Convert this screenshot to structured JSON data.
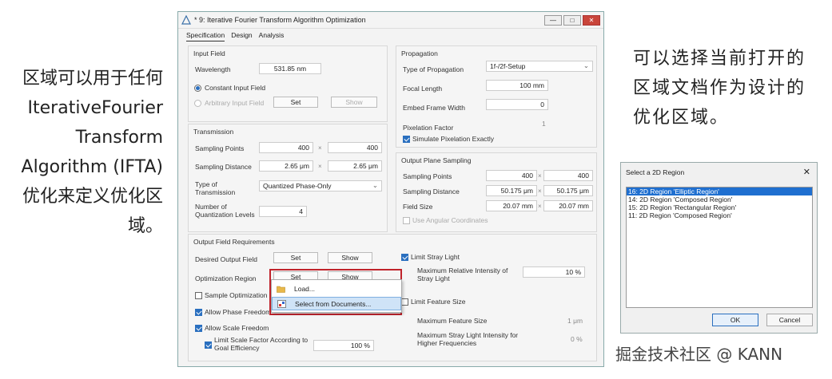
{
  "annotations": {
    "left": "区域可以用于任何 IterativeFourier Transform Algorithm (IFTA)优化来定义优化区域。",
    "right": "可以选择当前打开的区域文档作为设计的优化区域。",
    "watermark": "掘金技术社区 @ KANN"
  },
  "window": {
    "title": "* 9: Iterative Fourier Transform Algorithm Optimization",
    "buttons": {
      "minimize": "—",
      "maximize": "□",
      "close": "✕"
    },
    "tabs": [
      "Specification",
      "Design",
      "Analysis"
    ]
  },
  "input_field": {
    "title": "Input Field",
    "wavelength_label": "Wavelength",
    "wavelength_value": "531.85 nm",
    "constant_label": "Constant Input Field",
    "arbitrary_label": "Arbitrary Input Field",
    "set_label": "Set",
    "show_label": "Show"
  },
  "transmission": {
    "title": "Transmission",
    "sampling_points_label": "Sampling Points",
    "sampling_points_x": "400",
    "sampling_points_y": "400",
    "sampling_distance_label": "Sampling Distance",
    "sampling_distance_x": "2.65 μm",
    "sampling_distance_y": "2.65 μm",
    "type_label": "Type of Transmission",
    "type_value": "Quantized Phase-Only",
    "levels_label": "Number of Quantization Levels",
    "levels_value": "4",
    "times": "×"
  },
  "propagation": {
    "title": "Propagation",
    "type_label": "Type of Propagation",
    "type_value": "1f-/2f-Setup",
    "focal_label": "Focal Length",
    "focal_value": "100 mm",
    "embed_label": "Embed Frame Width",
    "embed_value": "0",
    "pixelation_label": "Pixelation Factor",
    "pixelation_value": "1",
    "simulate_label": "Simulate Pixelation Exactly"
  },
  "output_sampling": {
    "title": "Output Plane Sampling",
    "points_label": "Sampling Points",
    "points_x": "400",
    "points_y": "400",
    "distance_label": "Sampling Distance",
    "distance_x": "50.175 μm",
    "distance_y": "50.175 μm",
    "size_label": "Field Size",
    "size_x": "20.07 mm",
    "size_y": "20.07 mm",
    "angular_label": "Use Angular Coordinates"
  },
  "requirements": {
    "title": "Output Field Requirements",
    "desired_label": "Desired Output Field",
    "opt_region_label": "Optimization Region",
    "set_label": "Set",
    "show_label": "Show",
    "sample_opt_label": "Sample Optimization",
    "phase_freedom_label": "Allow Phase Freedom",
    "scale_freedom_label": "Allow Scale Freedom",
    "limit_scale_label": "Limit Scale Factor According to Goal Efficiency",
    "limit_scale_value": "100 %",
    "stray_label": "Limit Stray Light",
    "max_rel_label": "Maximum Relative Intensity of Stray Light",
    "max_rel_value": "10 %",
    "feature_label": "Limit Feature Size",
    "max_feature_label": "Maximum Feature Size",
    "max_feature_value": "1 μm",
    "max_stray_hf_label": "Maximum Stray Light Intensity for Higher Frequencies",
    "max_stray_hf_value": "0 %"
  },
  "context_menu": {
    "items": [
      "Load...",
      "Select from Documents..."
    ]
  },
  "dialog": {
    "title": "Select a 2D Region",
    "close": "✕",
    "items": [
      "16: 2D Region 'Elliptic Region'",
      "14: 2D Region 'Composed Region'",
      "15: 2D Region 'Rectangular Region'",
      "11: 2D Region 'Composed Region'"
    ],
    "ok_label": "OK",
    "cancel_label": "Cancel"
  }
}
